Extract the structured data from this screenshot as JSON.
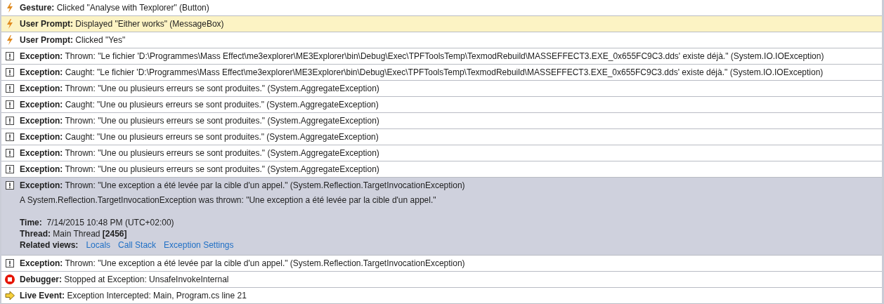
{
  "events": [
    {
      "kind": "gesture",
      "category": "Gesture:",
      "text": "Clicked \"Analyse with Texplorer\" (Button)",
      "selected": false,
      "expanded": false
    },
    {
      "kind": "gesture",
      "category": "User Prompt:",
      "text": "Displayed \"Either works\" (MessageBox)",
      "selected": true,
      "expanded": false
    },
    {
      "kind": "gesture",
      "category": "User Prompt:",
      "text": "Clicked \"Yes\"",
      "selected": false,
      "expanded": false
    },
    {
      "kind": "exception",
      "category": "Exception:",
      "text": "Thrown: \"Le fichier 'D:\\Programmes\\Mass Effect\\me3explorer\\ME3Explorer\\bin\\Debug\\Exec\\TPFToolsTemp\\TexmodRebuild\\MASSEFFECT3.EXE_0x655FC9C3.dds' existe déjà.\" (System.IO.IOException)",
      "selected": false,
      "expanded": false
    },
    {
      "kind": "exception",
      "category": "Exception:",
      "text": "Caught: \"Le fichier 'D:\\Programmes\\Mass Effect\\me3explorer\\ME3Explorer\\bin\\Debug\\Exec\\TPFToolsTemp\\TexmodRebuild\\MASSEFFECT3.EXE_0x655FC9C3.dds' existe déjà.\" (System.IO.IOException)",
      "selected": false,
      "expanded": false
    },
    {
      "kind": "exception",
      "category": "Exception:",
      "text": "Thrown: \"Une ou plusieurs erreurs se sont produites.\" (System.AggregateException)",
      "selected": false,
      "expanded": false
    },
    {
      "kind": "exception",
      "category": "Exception:",
      "text": "Caught: \"Une ou plusieurs erreurs se sont produites.\" (System.AggregateException)",
      "selected": false,
      "expanded": false
    },
    {
      "kind": "exception",
      "category": "Exception:",
      "text": "Thrown: \"Une ou plusieurs erreurs se sont produites.\" (System.AggregateException)",
      "selected": false,
      "expanded": false
    },
    {
      "kind": "exception",
      "category": "Exception:",
      "text": "Caught: \"Une ou plusieurs erreurs se sont produites.\" (System.AggregateException)",
      "selected": false,
      "expanded": false
    },
    {
      "kind": "exception",
      "category": "Exception:",
      "text": "Thrown: \"Une ou plusieurs erreurs se sont produites.\" (System.AggregateException)",
      "selected": false,
      "expanded": false
    },
    {
      "kind": "exception",
      "category": "Exception:",
      "text": "Thrown: \"Une ou plusieurs erreurs se sont produites.\" (System.AggregateException)",
      "selected": false,
      "expanded": false
    },
    {
      "kind": "exception",
      "category": "Exception:",
      "text": "Thrown: \"Une exception a été levée par la cible d'un appel.\" (System.Reflection.TargetInvocationException)",
      "selected": false,
      "expanded": true,
      "details": {
        "message": "A System.Reflection.TargetInvocationException was thrown: \"Une exception a été levée par la cible d'un appel.\"",
        "time_label": "Time:",
        "time": "7/14/2015 10:48 PM (UTC+02:00)",
        "thread_label": "Thread:",
        "thread": "Main Thread **[2456]**",
        "related_label": "Related views:",
        "links": [
          "Locals",
          "Call Stack",
          "Exception Settings"
        ]
      }
    },
    {
      "kind": "exception",
      "category": "Exception:",
      "text": "Thrown: \"Une exception a été levée par la cible d'un appel.\" (System.Reflection.TargetInvocationException)",
      "selected": false,
      "expanded": false
    },
    {
      "kind": "debugger",
      "category": "Debugger:",
      "text": "Stopped at Exception: UnsafeInvokeInternal",
      "selected": false,
      "expanded": false
    },
    {
      "kind": "live_event",
      "category": "Live Event:",
      "text": "Exception Intercepted: Main, Program.cs line 21",
      "selected": false,
      "expanded": false
    }
  ]
}
